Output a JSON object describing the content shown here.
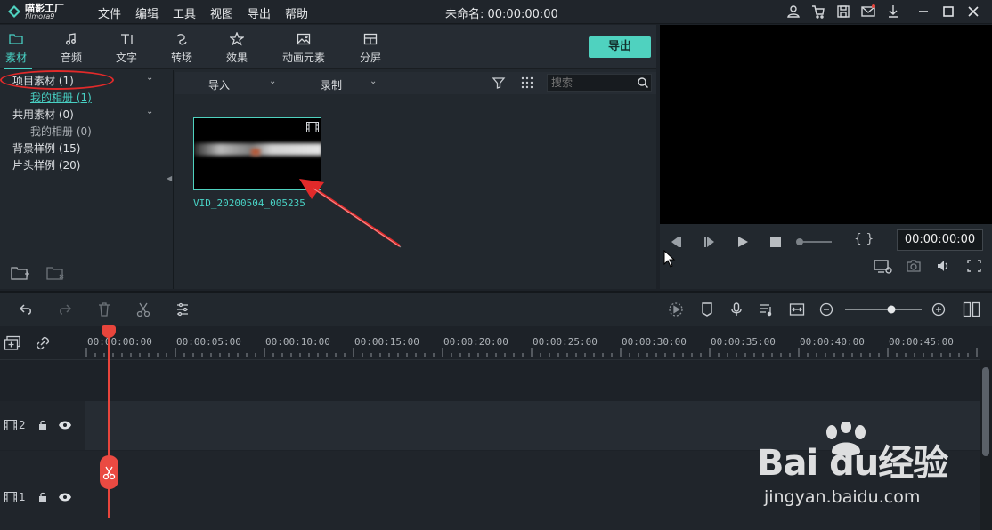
{
  "app": {
    "logo_name": "喵影工厂",
    "logo_sub": "filmora9",
    "menu": [
      "文件",
      "编辑",
      "工具",
      "视图",
      "导出",
      "帮助"
    ],
    "doc_title": "未命名: 00:00:00:00"
  },
  "tabs": [
    {
      "label": "素材",
      "icon": "folder-icon",
      "active": true
    },
    {
      "label": "音频",
      "icon": "music-note-icon"
    },
    {
      "label": "文字",
      "icon": "text-icon"
    },
    {
      "label": "转场",
      "icon": "transition-icon"
    },
    {
      "label": "效果",
      "icon": "effects-star-icon"
    },
    {
      "label": "动画元素",
      "icon": "image-icon"
    },
    {
      "label": "分屏",
      "icon": "split-screen-icon"
    }
  ],
  "export_label": "导出",
  "sidebar": {
    "items": [
      {
        "label": "项目素材 (1)",
        "expandable": true
      },
      {
        "label": "我的相册 (1)",
        "sub": true,
        "selected": true
      },
      {
        "label": "共用素材 (0)",
        "expandable": true
      },
      {
        "label": "我的相册 (0)",
        "sub": true
      },
      {
        "label": "背景样例 (15)"
      },
      {
        "label": "片头样例 (20)"
      }
    ]
  },
  "media_toolbar": {
    "import_label": "导入",
    "record_label": "录制",
    "search_placeholder": "搜索"
  },
  "media_item": {
    "name": "VID_20200504_005235"
  },
  "preview": {
    "timecode": "00:00:00:00",
    "braces": "{ }"
  },
  "timeline": {
    "ruler_labels": [
      "00:00:00:00",
      "00:00:05:00",
      "00:00:10:00",
      "00:00:15:00",
      "00:00:20:00",
      "00:00:25:00",
      "00:00:30:00",
      "00:00:35:00",
      "00:00:40:00",
      "00:00:45:00"
    ],
    "tracks": [
      {
        "number": "2"
      },
      {
        "number": "1"
      }
    ]
  },
  "watermark": {
    "big": "Bai du经验",
    "small": "jingyan.baidu.com"
  },
  "colors": {
    "accent": "#48d0c3",
    "playhead": "#e8453c",
    "annotation": "#e12a2a"
  }
}
